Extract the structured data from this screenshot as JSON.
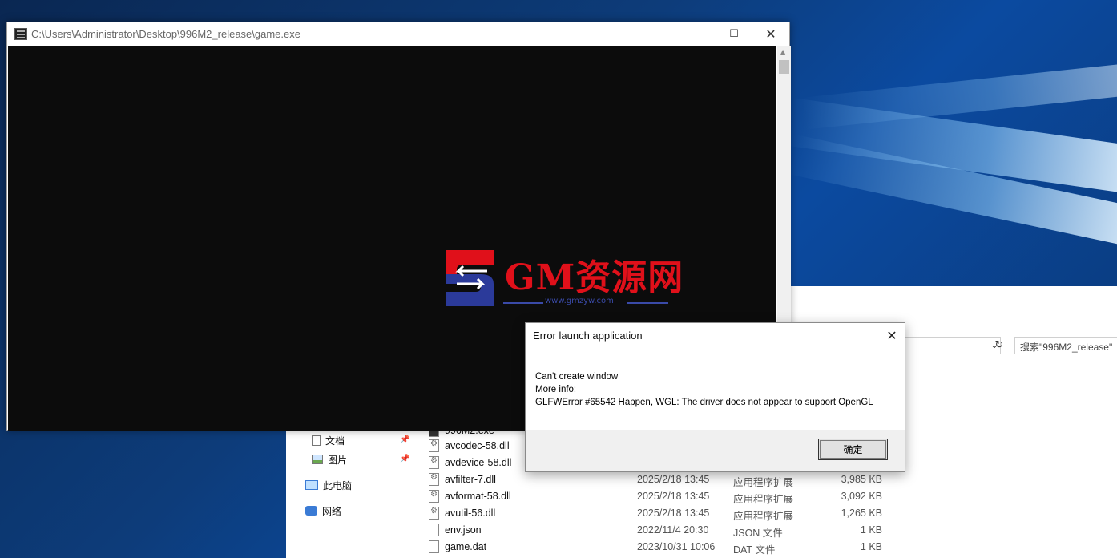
{
  "console": {
    "title": "C:\\Users\\Administrator\\Desktop\\996M2_release\\game.exe"
  },
  "watermark": {
    "text": "GM资源网",
    "url": "www.gmzyw.com",
    "colors": {
      "red": "#e0101a",
      "blue": "#2b3a9a"
    }
  },
  "dialog": {
    "title": "Error launch application",
    "message_lines": [
      "Can't create window",
      "More info:",
      "GLFWError #65542 Happen, WGL: The driver does not appear to support OpenGL"
    ],
    "ok_label": "确定"
  },
  "explorer": {
    "search_placeholder": "搜索\"996M2_release\"",
    "partial_item": "996M2.exe",
    "nav": [
      {
        "label": "文档",
        "icon": "document-icon"
      },
      {
        "label": "图片",
        "icon": "picture-icon"
      },
      {
        "label": "此电脑",
        "icon": "computer-icon"
      },
      {
        "label": "网络",
        "icon": "network-icon"
      }
    ],
    "files": [
      {
        "name": "avcodec-58.dll",
        "date": "",
        "type": "",
        "size": ""
      },
      {
        "name": "avdevice-58.dll",
        "date": "",
        "type": "",
        "size": ""
      },
      {
        "name": "avfilter-7.dll",
        "date": "2025/2/18 13:45",
        "type": "应用程序扩展",
        "size": "3,985 KB"
      },
      {
        "name": "avformat-58.dll",
        "date": "2025/2/18 13:45",
        "type": "应用程序扩展",
        "size": "3,092 KB"
      },
      {
        "name": "avutil-56.dll",
        "date": "2025/2/18 13:45",
        "type": "应用程序扩展",
        "size": "1,265 KB"
      },
      {
        "name": "env.json",
        "date": "2022/11/4 20:30",
        "type": "JSON 文件",
        "size": "1 KB"
      },
      {
        "name": "game.dat",
        "date": "2023/10/31 10:06",
        "type": "DAT 文件",
        "size": "1 KB"
      }
    ]
  }
}
